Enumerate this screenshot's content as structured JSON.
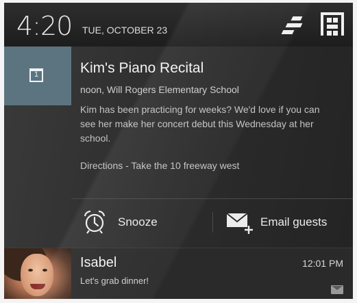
{
  "status_bar": {
    "time": "4:20",
    "date": "TUE, OCTOBER 23",
    "settings_icon": "settings-toggle-icon",
    "quick_settings_icon": "quick-settings-icon"
  },
  "calendar_notification": {
    "icon": "calendar-icon",
    "icon_day": "1",
    "title": "Kim's Piano Recital",
    "subtitle": "noon, Will Rogers Elementary School",
    "body": "Kim has been practicing for weeks? We'd love if you can see her make her concert debut this Wednesday at her school.",
    "directions": "Directions - Take the 10 freeway west",
    "actions": [
      {
        "label": "Snooze",
        "icon": "alarm-clock-icon"
      },
      {
        "label": "Email guests",
        "icon": "email-add-icon"
      }
    ],
    "accent_color": "#5c7480"
  },
  "message_notification": {
    "sender": "Isabel",
    "time": "12:01 PM",
    "text": "Let's grab dinner!",
    "icon": "mail-icon"
  }
}
